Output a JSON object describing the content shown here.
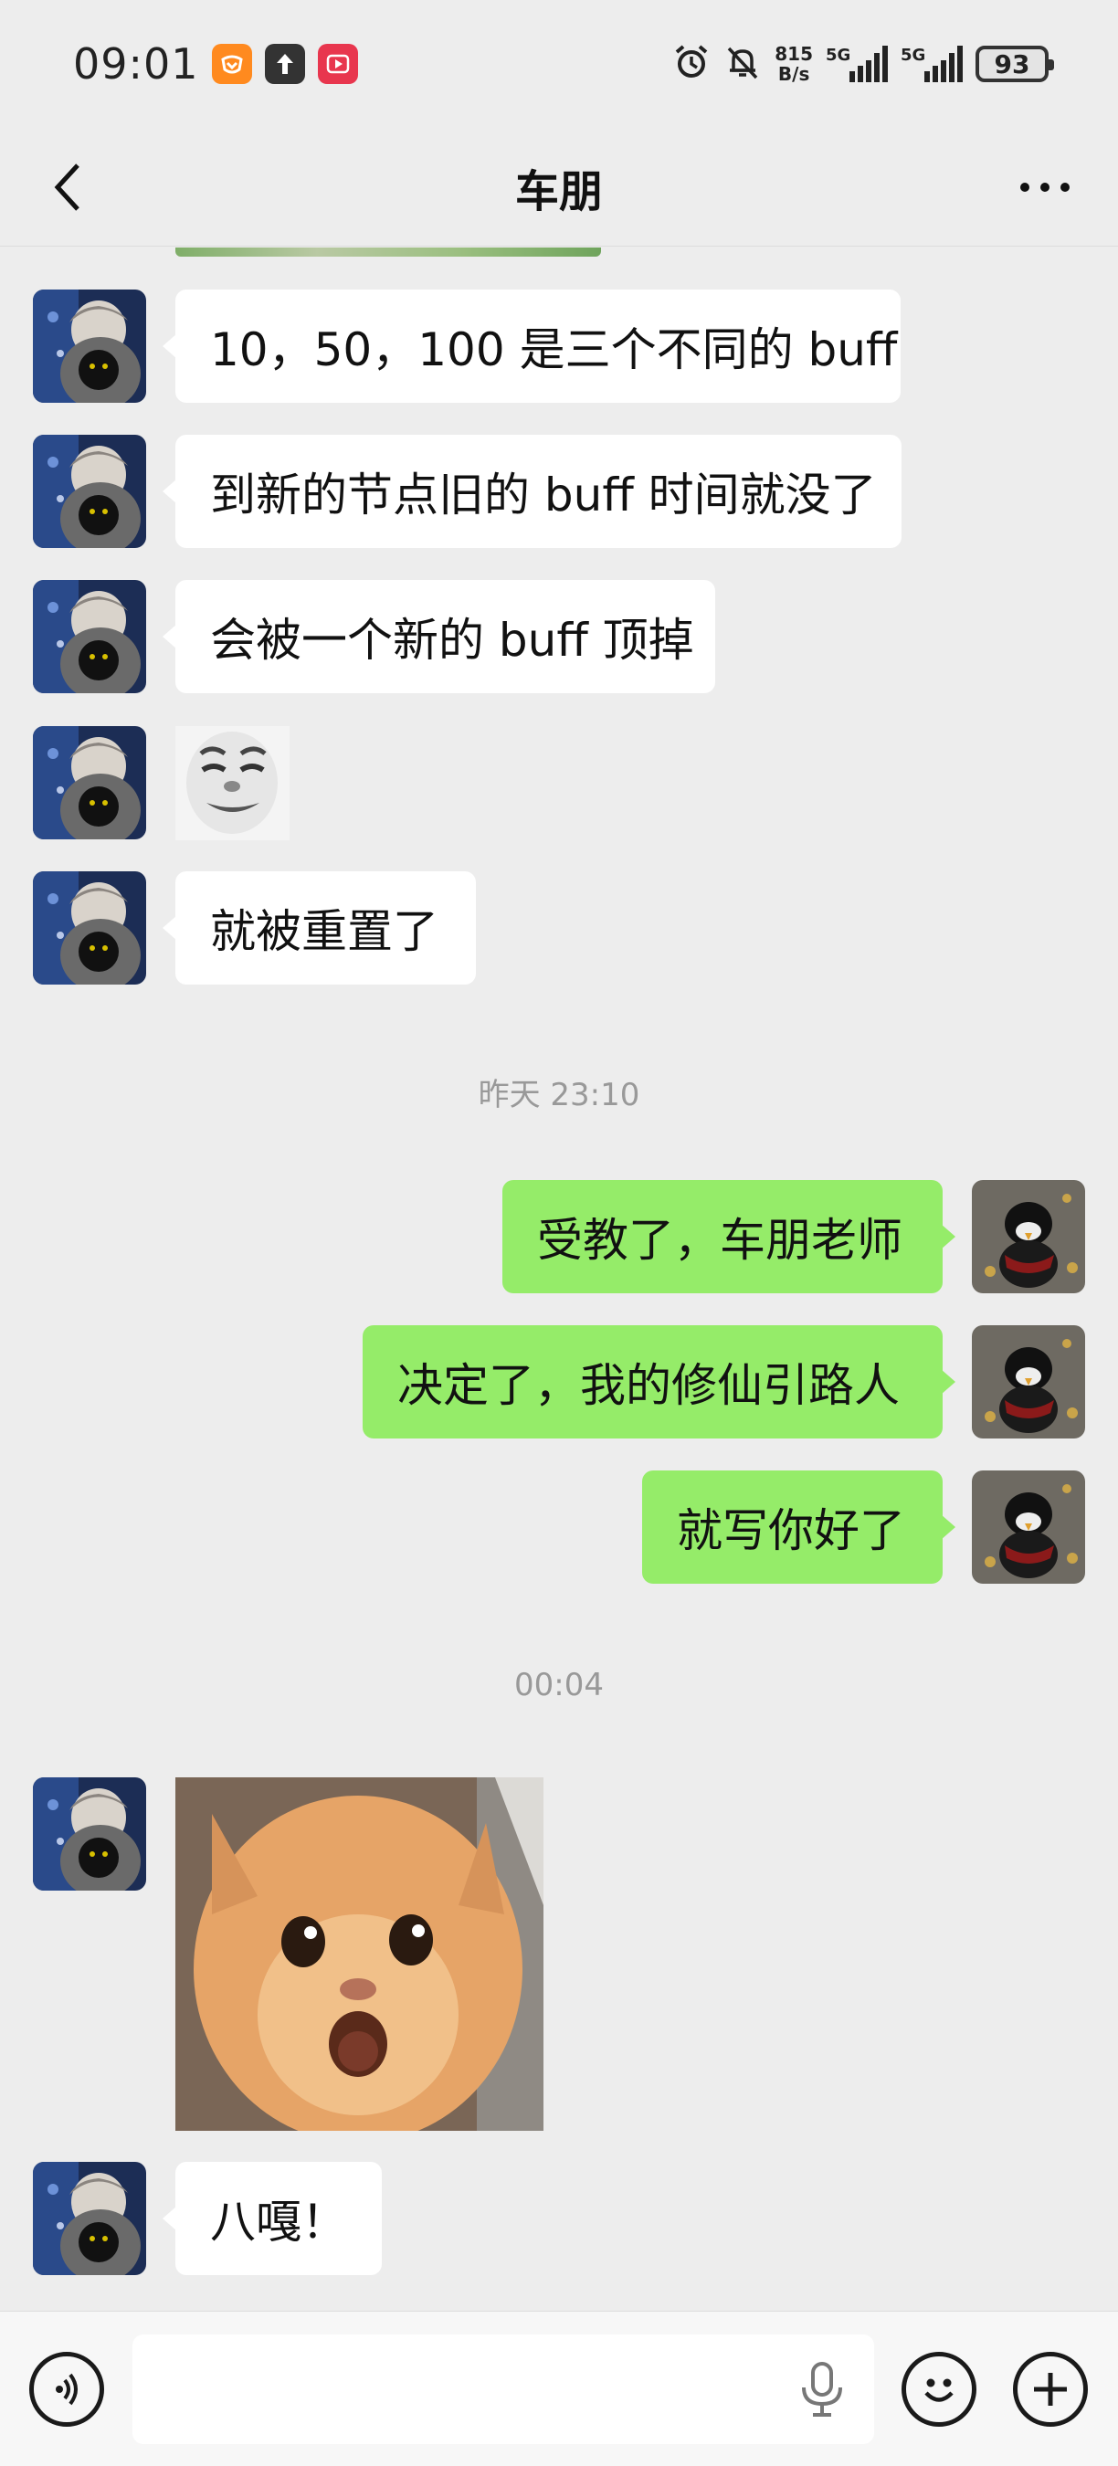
{
  "status_bar": {
    "time": "09:01",
    "net_speed_value": "815",
    "net_speed_unit": "B/s",
    "signal1_label": "5G",
    "signal2_label": "5G",
    "battery": "93"
  },
  "header": {
    "title": "车朋"
  },
  "messages": [
    {
      "side": "in",
      "type": "text",
      "text": "10，50，100 是三个不同的 buff"
    },
    {
      "side": "in",
      "type": "text",
      "text": "到新的节点旧的 buff 时间就没了"
    },
    {
      "side": "in",
      "type": "text",
      "text": "会被一个新的 buff 顶掉"
    },
    {
      "side": "in",
      "type": "sticker",
      "icon": "laughing-face-sticker"
    },
    {
      "side": "in",
      "type": "text",
      "text": "就被重置了"
    },
    {
      "type": "timestamp",
      "text": "昨天 23:10"
    },
    {
      "side": "out",
      "type": "text",
      "text": "受教了，车朋老师"
    },
    {
      "side": "out",
      "type": "text",
      "text": "决定了，我的修仙引路人"
    },
    {
      "side": "out",
      "type": "text",
      "text": "就写你好了"
    },
    {
      "type": "timestamp",
      "text": "00:04"
    },
    {
      "side": "in",
      "type": "sticker",
      "icon": "surprised-cat-sticker"
    },
    {
      "side": "in",
      "type": "text",
      "text": "八嘎！"
    }
  ],
  "colors": {
    "outgoing_bubble": "#95ec69",
    "incoming_bubble": "#ffffff",
    "background": "#ededed"
  }
}
